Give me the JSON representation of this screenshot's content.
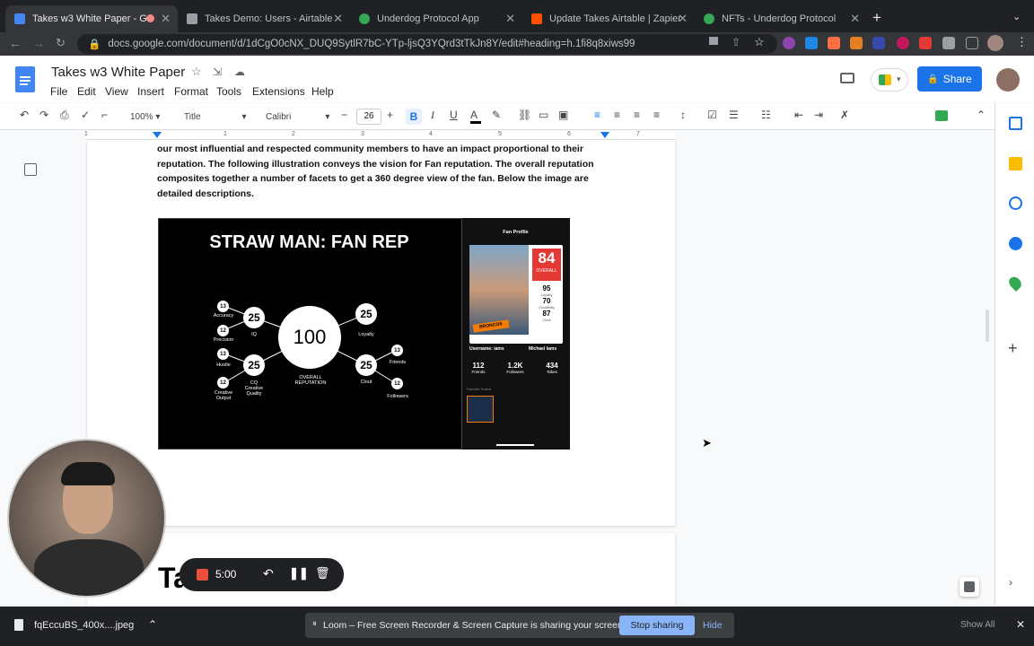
{
  "browser": {
    "tabs": [
      {
        "title": "Takes w3 White Paper - Go",
        "color": "#4285f4",
        "active": true
      },
      {
        "title": "Takes Demo: Users - Airtable",
        "color": "#9aa0a6",
        "active": false
      },
      {
        "title": "Underdog Protocol App",
        "color": "#34a853",
        "active": false
      },
      {
        "title": "Update Takes Airtable | Zapier",
        "color": "#ff4f00",
        "active": false
      },
      {
        "title": "NFTs - Underdog Protocol",
        "color": "#34a853",
        "active": false
      }
    ],
    "url": "docs.google.com/document/d/1dCgO0cNX_DUQ9SytlR7bC-YTp-ljsQ3YQrd3tTkJn8Y/edit#heading=h.1fi8q8xiws99"
  },
  "doc": {
    "title": "Takes w3 White Paper",
    "share_label": "Share",
    "menu": [
      "File",
      "Edit",
      "View",
      "Insert",
      "Format",
      "Tools",
      "Extensions",
      "Help"
    ],
    "toolbar": {
      "zoom": "100%",
      "style": "Title",
      "font": "Calibri",
      "font_size": "26"
    },
    "ruler_marks": [
      "1",
      "1",
      "2",
      "3",
      "4",
      "5",
      "6",
      "7"
    ],
    "paragraph": [
      "our most influential and respected community members to have an impact proportional to their",
      "reputation. The following illustration conveys the vision for Fan reputation. The overall reputation",
      "composites together a number of facets to get a 360 degree view of the fan. Below the image are",
      "detailed descriptions."
    ],
    "next_heading": "Ta"
  },
  "figure": {
    "title": "STRAW MAN: FAN REP",
    "center": {
      "value": "100",
      "label": "OVERALL\nREPUTATION"
    },
    "facets": [
      {
        "value": "25",
        "label": "IQ"
      },
      {
        "value": "25",
        "label": "CQ\nCreative\nQuality"
      },
      {
        "value": "25",
        "label": "Loyalty"
      },
      {
        "value": "25",
        "label": "Clout"
      }
    ],
    "subfacets": [
      {
        "value": "13",
        "label": "Accuracy"
      },
      {
        "value": "12",
        "label": "Precision"
      },
      {
        "value": "13",
        "label": "Hustle"
      },
      {
        "value": "12",
        "label": "Creative\nOutput"
      },
      {
        "value": "13",
        "label": "Friends"
      },
      {
        "value": "12",
        "label": "Followers"
      }
    ],
    "profile": {
      "header": "Fan Profile",
      "overall_value": "84",
      "overall_label": "OVERALL",
      "stats": [
        {
          "v": "95",
          "l": "Loyalty"
        },
        {
          "v": "70",
          "l": "Credibility"
        },
        {
          "v": "87",
          "l": "Clout"
        }
      ],
      "team": "BRONCOS",
      "username": "Username: iams",
      "name": "Michael Iams",
      "counts": [
        {
          "v": "112",
          "l": "Friends"
        },
        {
          "v": "1.2K",
          "l": "Followers"
        },
        {
          "v": "434",
          "l": "Takes"
        }
      ],
      "fav_label": "Favorite Teams"
    }
  },
  "loom": {
    "timer": "5:00",
    "share_msg": "Loom – Free Screen Recorder & Screen Capture is sharing your screen.",
    "stop_label": "Stop sharing",
    "hide_label": "Hide"
  },
  "downloads": {
    "file": "fqEccuBS_400x....jpeg",
    "show_all": "Show All"
  },
  "colors": {
    "accent": "#1a73e8",
    "chrome_dark": "#202124",
    "loom_red": "#e94f3a"
  }
}
